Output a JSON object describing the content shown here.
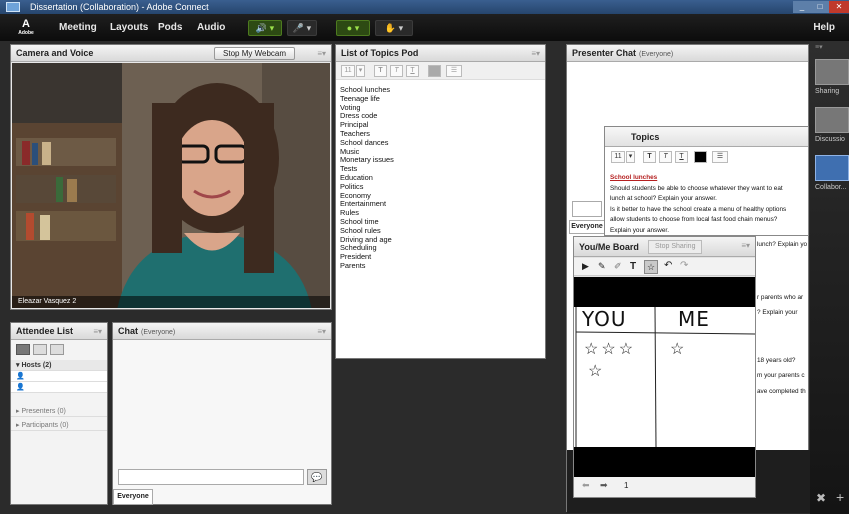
{
  "window": {
    "title": "Dissertation (Collaboration) - Adobe Connect"
  },
  "menu": {
    "logo_text": "Adobe",
    "items": [
      "Meeting",
      "Layouts",
      "Pods",
      "Audio"
    ],
    "help": "Help"
  },
  "camera": {
    "title": "Camera and Voice",
    "stop_button": "Stop My Webcam",
    "name_bar": "Eleazar Vasquez 2"
  },
  "topics_pod": {
    "title": "List of Topics Pod",
    "font_size": "11",
    "topics": [
      "School lunches",
      "Teenage life",
      "Voting",
      "Dress code",
      "Principal",
      "Teachers",
      "School dances",
      "Music",
      "Monetary issues",
      "Tests",
      "Education",
      "Politics",
      "Economy",
      "Entertainment",
      "Rules",
      "School time",
      "School rules",
      "Driving and age",
      "Scheduling",
      "President",
      "Parents"
    ]
  },
  "attendee": {
    "title": "Attendee List",
    "hosts": "Hosts (2)",
    "presenters": "Presenters (0)",
    "participants": "Participants (0)"
  },
  "chat": {
    "title": "Chat",
    "scope": "(Everyone)",
    "tab": "Everyone"
  },
  "presenter_chat": {
    "title": "Presenter Chat",
    "scope": "(Everyone)",
    "tab": "Everyone",
    "partial_lines": [
      "lunch? Explain yo",
      "r parents who ar",
      "? Explain your",
      "18 years old?",
      "m your parents c",
      "ave completed th"
    ]
  },
  "topics_note": {
    "title": "Topics",
    "font_size": "11",
    "heading": "School lunches",
    "lines": [
      "Should students be able to choose whatever they want to eat",
      "lunch at school? Explain your answer.",
      "Is it better to have the school create a menu of healthy options",
      "allow students to choose from local fast food chain menus?",
      "Explain your answer."
    ]
  },
  "board": {
    "title": "You/Me Board",
    "stop_sharing": "Stop Sharing",
    "col_you": "YOU",
    "col_me": "ME",
    "page": "1"
  },
  "sidebar": {
    "layouts": [
      "Sharing",
      "Discussio",
      "Collabor..."
    ]
  },
  "colors": {
    "accent_green": "#9be04a",
    "note_heading": "#b52020",
    "selected_layout": "#3f6fb0"
  }
}
